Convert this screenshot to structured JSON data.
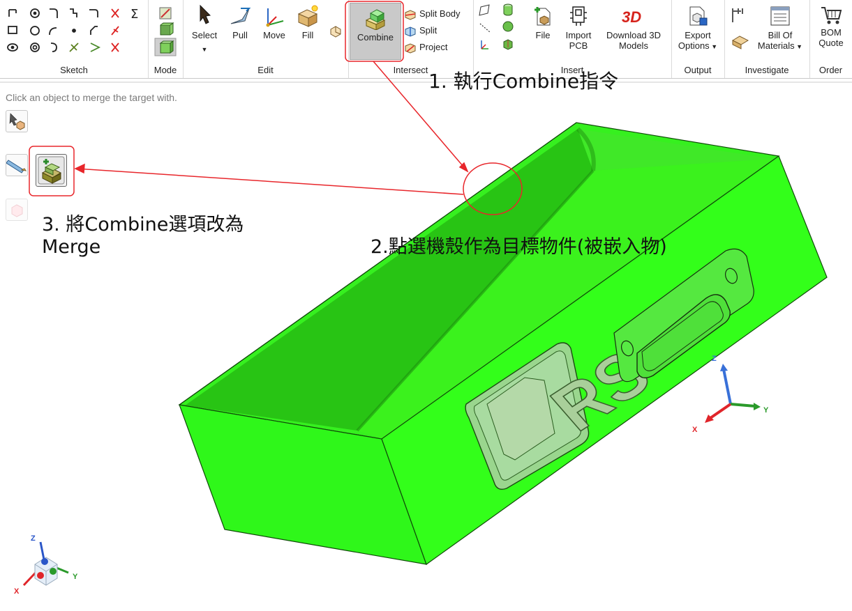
{
  "ribbon": {
    "groups": {
      "sketch": "Sketch",
      "mode": "Mode",
      "edit": "Edit",
      "intersect": "Intersect",
      "insert": "Insert",
      "output": "Output",
      "investigate": "Investigate",
      "order": "Order"
    },
    "edit_buttons": {
      "select": "Select",
      "pull": "Pull",
      "move": "Move",
      "fill": "Fill"
    },
    "combine": "Combine",
    "intersect_items": [
      "Split Body",
      "Split",
      "Project"
    ],
    "insert_buttons": {
      "file": "File",
      "import_pcb": "Import PCB",
      "download_3d": "Download 3D Models"
    },
    "output_button": "Export Options",
    "investigate_button": "Bill Of Materials",
    "order_button": "BOM Quote"
  },
  "canvas": {
    "hint": "Click an object to merge the target with.",
    "annotation_1": "1. 執行Combine指令",
    "annotation_2": "2.點選機殼作為目標物件(被嵌入物)",
    "annotation_3_line1": "3. 將Combine選項改為",
    "annotation_3_line2": "Merge",
    "logo_text": "RS",
    "axis_main": {
      "x": "X",
      "y": "Y",
      "z": "Z"
    },
    "axis_corner": {
      "x": "X",
      "y": "Y",
      "z": "Z"
    }
  },
  "colors": {
    "body": "#33ff1a",
    "annotation_red": "#e8262b",
    "selected_button": "#c9c9c9"
  }
}
